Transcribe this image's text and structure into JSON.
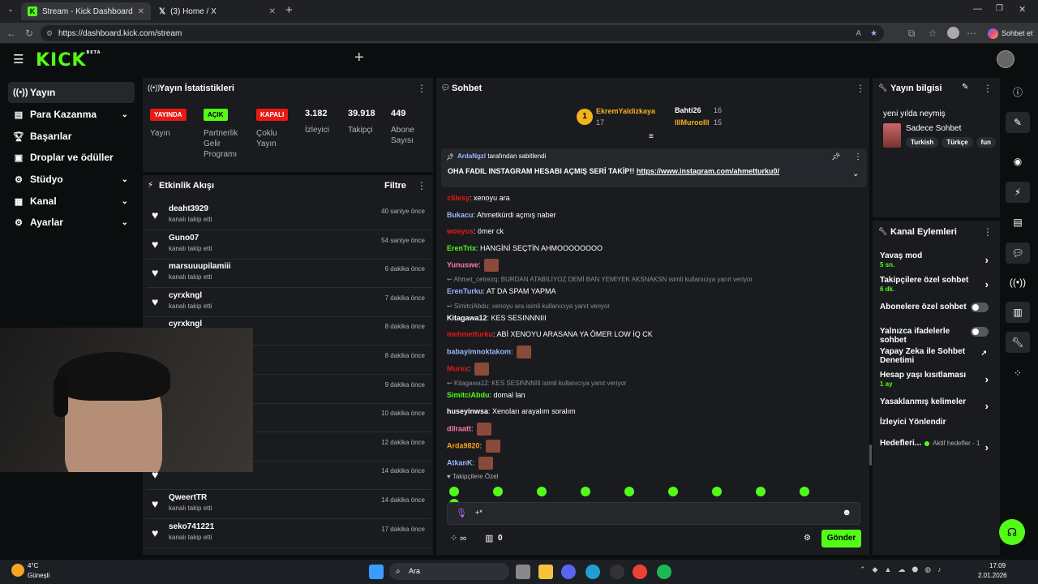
{
  "browser": {
    "tabs": [
      {
        "label": "Stream - Kick Dashboard",
        "icon": "kick-logo-icon"
      },
      {
        "label": "(3) Home / X",
        "icon": "x-logo-icon"
      }
    ],
    "url": "https://dashboard.kick.com/stream",
    "profile_button": "Sohbet et"
  },
  "app": {
    "logo": "KICK",
    "logo_tag": "BETA",
    "add": "+"
  },
  "sidebar": {
    "items": [
      {
        "label": "Yayın",
        "icon": "broadcast-icon",
        "active": true
      },
      {
        "label": "Para Kazanma",
        "icon": "money-icon",
        "chevron": true
      },
      {
        "label": "Başarılar",
        "icon": "trophy-icon"
      },
      {
        "label": "Droplar ve ödüller",
        "icon": "gift-icon"
      },
      {
        "label": "Stüdyo",
        "icon": "studio-icon",
        "chevron": true
      },
      {
        "label": "Kanal",
        "icon": "channel-icon",
        "chevron": true
      },
      {
        "label": "Ayarlar",
        "icon": "gear-icon",
        "chevron": true
      }
    ]
  },
  "stats": {
    "title": "Yayın İstatistikleri",
    "items": [
      {
        "badge": "YAYINDA",
        "badge_color": "#e91916",
        "label": "Yayın"
      },
      {
        "badge": "AÇIK",
        "badge_color": "#53fc18",
        "label": "Partnerlik Gelir Programı"
      },
      {
        "badge": "KAPALI",
        "badge_color": "#e91916",
        "label": "Çoklu Yayın"
      },
      {
        "value": "3.182",
        "label": "İzleyici"
      },
      {
        "value": "39.918",
        "label": "Takipçi"
      },
      {
        "value": "449",
        "label": "Abone Sayısı"
      }
    ]
  },
  "activity": {
    "title": "Etkinlik Akışı",
    "filter": "Filtre",
    "items": [
      {
        "name": "deaht3929",
        "sub": "kanalı takip etti",
        "time": "40 saniye önce"
      },
      {
        "name": "Guno07",
        "sub": "kanalı takip etti",
        "time": "54 saniye önce"
      },
      {
        "name": "marsuuupilamiii",
        "sub": "kanalı takip etti",
        "time": "6 dakika önce"
      },
      {
        "name": "cyrxkngl",
        "sub": "kanalı takip etti",
        "time": "7 dakika önce"
      },
      {
        "name": "cyrxkngl",
        "sub": "",
        "time": "8 dakika önce"
      },
      {
        "name": "",
        "sub": "",
        "time": "8 dakika önce"
      },
      {
        "name": "",
        "sub": "",
        "time": "9 dakika önce"
      },
      {
        "name": "",
        "sub": "",
        "time": "10 dakika önce"
      },
      {
        "name": "",
        "sub": "",
        "time": "12 dakika önce"
      },
      {
        "name": "",
        "sub": "",
        "time": "14 dakika önce"
      },
      {
        "name": "QweertTR",
        "sub": "kanalı takip etti",
        "time": "14 dakika önce"
      },
      {
        "name": "seko741221",
        "sub": "kanalı takip etti",
        "time": "17 dakika önce"
      }
    ]
  },
  "chat": {
    "title": "Sohbet",
    "top": [
      {
        "rank": "1",
        "name": "EkremYaldizkaya",
        "count": "17"
      },
      {
        "name": "Bahti26",
        "count": "16"
      },
      {
        "name": "lllMuroolll",
        "count": "15"
      }
    ],
    "pinned": {
      "by": "ArdaNgzl",
      "by_suffix": "tarafından sabitlendi",
      "text": "OHA FADIL INSTAGRAM HESABI AÇMIŞ SERİ TAKİP!!",
      "link": "https://www.instagram.com/ahmetturku0/"
    },
    "messages": [
      {
        "user": "zSlesy",
        "color": "#e91916",
        "text": "xenoyu ara"
      },
      {
        "user": "Bukacu",
        "color": "#9bb8ff",
        "text": "Ahmetkürdi açmış naber"
      },
      {
        "user": "wosyus",
        "color": "#e91916",
        "text": "ömer ck"
      },
      {
        "user": "ErenTrix",
        "color": "#53fc18",
        "text": "HANGİNİ SEÇTİN AHMOOOOOOOO"
      },
      {
        "user": "Yunuswe",
        "color": "#ff7aa8",
        "text": ""
      },
      {
        "reply": "Ahmet_cetrezq: BURDAN ATABİLİYOZ DEMİ BAN YEMİYEK AKSNAKSN isimli kullanıcıya yanıt veriyor"
      },
      {
        "user": "ErenTurku",
        "color": "#9bb8ff",
        "text": "AT DA SPAM YAPMA"
      },
      {
        "reply": "SimitciAbdu: xenoyu ara isimli kullanıcıya yanıt veriyor"
      },
      {
        "user": "Kitagawa12",
        "color": "#ffffff",
        "text": "KES SESINNNIII"
      },
      {
        "user": "mehmetturku",
        "color": "#e91916",
        "text": "ABİ XENOYU ARASANA YA ÖMER LOW İQ CK"
      },
      {
        "user": "babayimnoktakom",
        "color": "#9bb8ff",
        "text": ""
      },
      {
        "user": "Murex",
        "color": "#e91916",
        "text": ""
      },
      {
        "reply": "Kitagawa12: KES SESINNNIII isimli kullanıcıya yanıt veriyor"
      },
      {
        "user": "SimitciAbdu",
        "color": "#53fc18",
        "text": "domal lan"
      },
      {
        "user": "huseyinwsa",
        "color": "#ffffff",
        "text": "Xenoları arayalım soralım"
      },
      {
        "user": "dilraatt",
        "color": "#ff7aa8",
        "text": ""
      },
      {
        "user": "Arda9820",
        "color": "#ff9f1a",
        "text": ""
      },
      {
        "user": "AtkanK",
        "color": "#9bb8ff",
        "text": ""
      }
    ],
    "followers_only": "Takipçilere Özel",
    "input_placeholder": "+*",
    "points": "0",
    "send": "Gönder"
  },
  "stream_info": {
    "title": "Yayın bilgisi",
    "stream_title": "yeni yılda neymiş",
    "category": "Sadece Sohbet",
    "tags": [
      "Turkish",
      "Türkçe",
      "fun"
    ]
  },
  "channel_actions": {
    "title": "Kanal Eylemleri",
    "items": [
      {
        "label": "Yavaş mod",
        "sub": "5 sn.",
        "control": "chevron"
      },
      {
        "label": "Takipçilere özel sohbet",
        "sub": "6 dk.",
        "control": "chevron"
      },
      {
        "label": "Abonelere özel sohbet",
        "control": "toggle"
      },
      {
        "label": "Yalnızca ifadelerle sohbet",
        "control": "toggle"
      },
      {
        "label": "Yapay Zeka ile Sohbet Denetimi",
        "control": "external"
      },
      {
        "label": "Hesap yaşı kısıtlaması",
        "sub": "1 ay",
        "control": "chevron"
      },
      {
        "label": "Yasaklanmış kelimeler",
        "control": "chevron"
      },
      {
        "label": "İzleyici Yönlendir",
        "control": "none"
      },
      {
        "label": "Hedefleri...",
        "sub": "Aktif hedefler - 1",
        "control": "chevron"
      }
    ]
  },
  "taskbar": {
    "weather_temp": "4°C",
    "weather_desc": "Güneşli",
    "search": "Ara",
    "time": "17:09",
    "date": "2.01.2026"
  },
  "colors": {
    "accent": "#53fc18",
    "live": "#e91916",
    "panel": "#191b1f",
    "bg": "#0b0e0f"
  }
}
